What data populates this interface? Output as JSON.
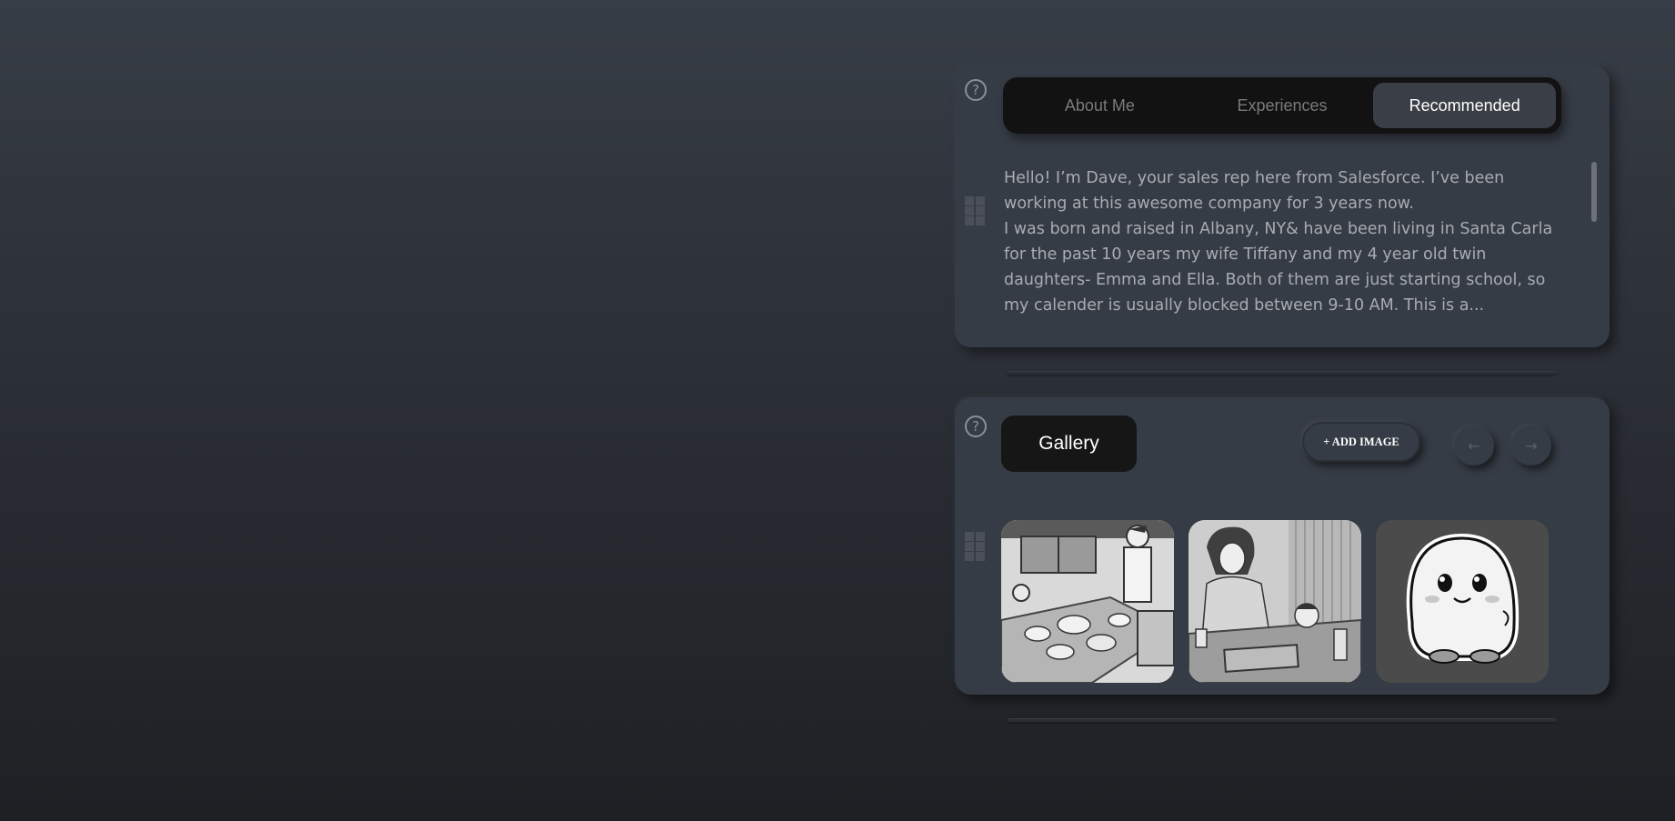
{
  "about_card": {
    "help_icon": "help-circle-icon",
    "grip_icon": "drag-grid-icon",
    "tabs": [
      {
        "label": "About Me",
        "active": false
      },
      {
        "label": "Experiences",
        "active": false
      },
      {
        "label": "Recommended",
        "active": true
      }
    ],
    "bio": {
      "line1": "Hello! I’m Dave, your sales rep here from Salesforce. I’ve been working at this awesome company for 3 years now.",
      "line2": "I was born and raised in Albany, NY& have been living in Santa Carla for the past 10 years my wife Tiffany and my 4 year old twin daughters- Emma and Ella. Both of them are just starting school, so my calender is usually blocked between 9-10 AM. This is a..."
    }
  },
  "gallery_card": {
    "help_icon": "help-circle-icon",
    "grip_icon": "drag-grid-icon",
    "title": "Gallery",
    "add_image_label": "+ ADD IMAGE",
    "prev_icon": "arrow-left-icon",
    "next_icon": "arrow-right-icon",
    "images": [
      {
        "name": "family-dinner-image"
      },
      {
        "name": "mother-child-table-image"
      },
      {
        "name": "cute-ghost-sticker-image"
      }
    ]
  },
  "colors": {
    "background_top": "#373d46",
    "background_bottom": "#1e2024",
    "card": "#363c45",
    "tab_bar": "#121212",
    "active_tab": "#3a3f47"
  }
}
